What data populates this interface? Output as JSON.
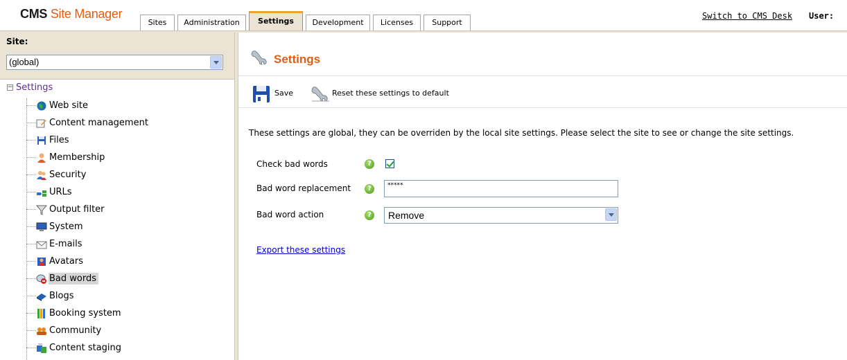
{
  "header": {
    "logo_cms": "CMS",
    "logo_rest": "Site Manager",
    "tabs": [
      {
        "label": "Sites",
        "active": false
      },
      {
        "label": "Administration",
        "active": false
      },
      {
        "label": "Settings",
        "active": true
      },
      {
        "label": "Development",
        "active": false
      },
      {
        "label": "Licenses",
        "active": false
      },
      {
        "label": "Support",
        "active": false
      }
    ],
    "switch_link": "Switch to CMS Desk",
    "user_label": "User:"
  },
  "sidebar": {
    "site_label": "Site:",
    "site_value": "(global)",
    "tree_root": "Settings",
    "items": [
      {
        "label": "Web site",
        "icon": "globe-icon"
      },
      {
        "label": "Content management",
        "icon": "edit-document-icon"
      },
      {
        "label": "Files",
        "icon": "floppy-icon"
      },
      {
        "label": "Membership",
        "icon": "user-icon"
      },
      {
        "label": "Security",
        "icon": "users-security-icon"
      },
      {
        "label": "URLs",
        "icon": "url-icon"
      },
      {
        "label": "Output filter",
        "icon": "filter-icon"
      },
      {
        "label": "System",
        "icon": "computer-icon"
      },
      {
        "label": "E-mails",
        "icon": "envelope-icon"
      },
      {
        "label": "Avatars",
        "icon": "avatar-icon"
      },
      {
        "label": "Bad words",
        "icon": "bad-words-icon",
        "selected": true
      },
      {
        "label": "Blogs",
        "icon": "blog-icon"
      },
      {
        "label": "Booking system",
        "icon": "booking-icon"
      },
      {
        "label": "Community",
        "icon": "community-icon"
      },
      {
        "label": "Content staging",
        "icon": "staging-icon"
      }
    ]
  },
  "main": {
    "title": "Settings",
    "toolbar": {
      "save_label": "Save",
      "reset_label": "Reset these settings to default"
    },
    "info_text": "These settings are global, they can be overriden by the local site settings. Please select the site to see or change the site settings.",
    "fields": {
      "check_bad_words_label": "Check bad words",
      "check_bad_words_checked": true,
      "replacement_label": "Bad word replacement",
      "replacement_value": "*****",
      "action_label": "Bad word action",
      "action_value": "Remove"
    },
    "export_link": "Export these settings"
  },
  "colors": {
    "accent_orange": "#e35d10",
    "panel_beige": "#ebe4d5",
    "link_blue": "#0000cc",
    "active_tab_top": "#f2a12b"
  }
}
